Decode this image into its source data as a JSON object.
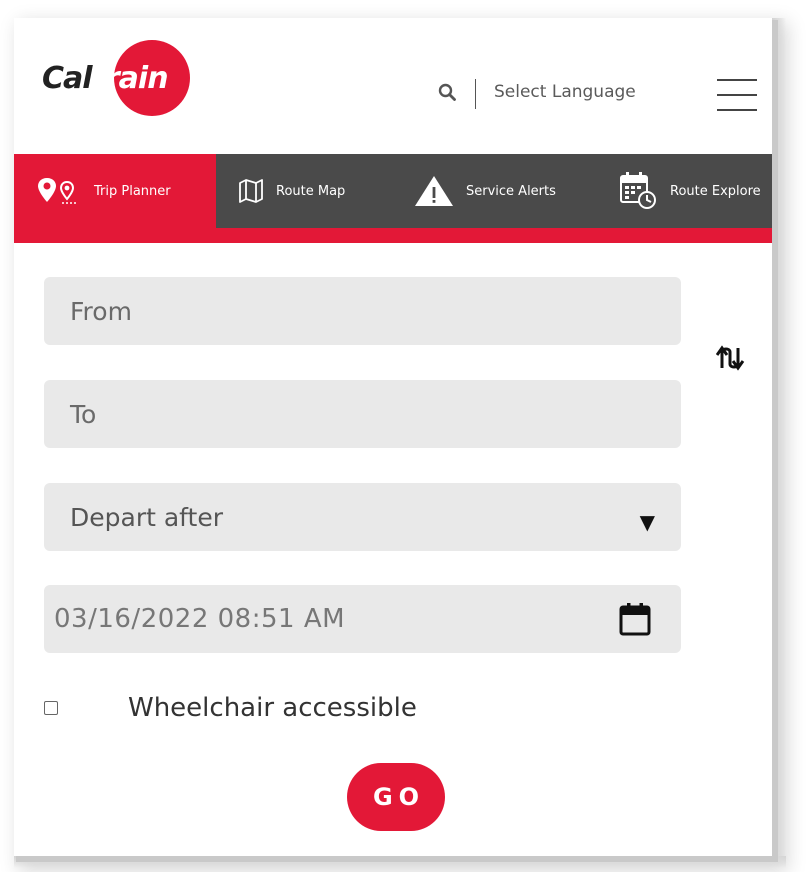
{
  "header": {
    "logo": {
      "text_cal": "Cal",
      "text_train": "train"
    },
    "search_icon": "search-icon",
    "language_label": "Select Language",
    "menu_icon": "hamburger-menu-icon"
  },
  "nav": {
    "items": [
      {
        "label": "Trip Planner",
        "icon": "map-pin-icon",
        "active": true
      },
      {
        "label": "Route Map",
        "icon": "folded-map-icon",
        "active": false
      },
      {
        "label": "Service Alerts",
        "icon": "warning-triangle-icon",
        "active": false
      },
      {
        "label": "Route Explore",
        "icon": "calendar-clock-icon",
        "active": false
      }
    ]
  },
  "form": {
    "from_placeholder": "From",
    "to_placeholder": "To",
    "depart_select_value": "Depart after",
    "datetime_value": "03/16/2022 08:51 AM",
    "wheelchair_label": "Wheelchair accessible",
    "wheelchair_checked": false,
    "go_label": "GO",
    "swap_icon": "swap-direction-icon",
    "calendar_icon": "calendar-icon"
  },
  "colors": {
    "brand_red": "#e31837",
    "nav_dark": "#4a4a4a",
    "field_bg": "#e9e9e9"
  }
}
